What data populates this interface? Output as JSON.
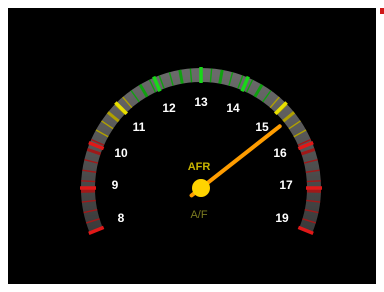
{
  "gauge": {
    "title": "AFR",
    "subtitle": "A/F",
    "scale_labels": [
      "8",
      "9",
      "10",
      "11",
      "12",
      "13",
      "14",
      "15",
      "16",
      "17",
      "19"
    ],
    "needle_value": 15.3,
    "bands": {
      "low_red": "#e01818",
      "yellow": "#e8e000",
      "green": "#18d818",
      "high_red": "#e01818"
    },
    "colors": {
      "needle": "#ff9d00",
      "hub": "#ffd400",
      "title": "#c8b400",
      "subtitle": "#7a7a20",
      "labels": "#ffffff",
      "arc": "#4a4a4a"
    }
  }
}
